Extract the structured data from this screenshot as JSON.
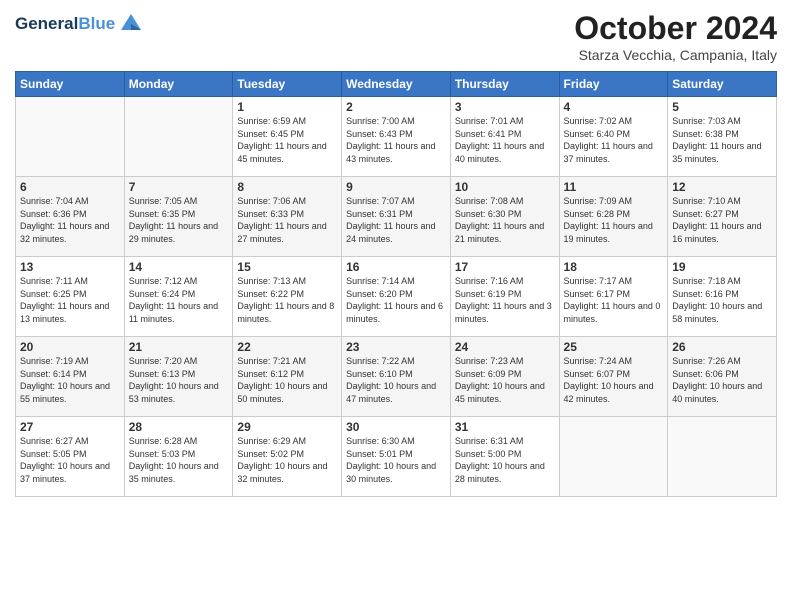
{
  "header": {
    "logo_line1": "General",
    "logo_line2": "Blue",
    "month_title": "October 2024",
    "subtitle": "Starza Vecchia, Campania, Italy"
  },
  "days_of_week": [
    "Sunday",
    "Monday",
    "Tuesday",
    "Wednesday",
    "Thursday",
    "Friday",
    "Saturday"
  ],
  "weeks": [
    [
      {
        "day": "",
        "info": ""
      },
      {
        "day": "",
        "info": ""
      },
      {
        "day": "1",
        "info": "Sunrise: 6:59 AM\nSunset: 6:45 PM\nDaylight: 11 hours and 45 minutes."
      },
      {
        "day": "2",
        "info": "Sunrise: 7:00 AM\nSunset: 6:43 PM\nDaylight: 11 hours and 43 minutes."
      },
      {
        "day": "3",
        "info": "Sunrise: 7:01 AM\nSunset: 6:41 PM\nDaylight: 11 hours and 40 minutes."
      },
      {
        "day": "4",
        "info": "Sunrise: 7:02 AM\nSunset: 6:40 PM\nDaylight: 11 hours and 37 minutes."
      },
      {
        "day": "5",
        "info": "Sunrise: 7:03 AM\nSunset: 6:38 PM\nDaylight: 11 hours and 35 minutes."
      }
    ],
    [
      {
        "day": "6",
        "info": "Sunrise: 7:04 AM\nSunset: 6:36 PM\nDaylight: 11 hours and 32 minutes."
      },
      {
        "day": "7",
        "info": "Sunrise: 7:05 AM\nSunset: 6:35 PM\nDaylight: 11 hours and 29 minutes."
      },
      {
        "day": "8",
        "info": "Sunrise: 7:06 AM\nSunset: 6:33 PM\nDaylight: 11 hours and 27 minutes."
      },
      {
        "day": "9",
        "info": "Sunrise: 7:07 AM\nSunset: 6:31 PM\nDaylight: 11 hours and 24 minutes."
      },
      {
        "day": "10",
        "info": "Sunrise: 7:08 AM\nSunset: 6:30 PM\nDaylight: 11 hours and 21 minutes."
      },
      {
        "day": "11",
        "info": "Sunrise: 7:09 AM\nSunset: 6:28 PM\nDaylight: 11 hours and 19 minutes."
      },
      {
        "day": "12",
        "info": "Sunrise: 7:10 AM\nSunset: 6:27 PM\nDaylight: 11 hours and 16 minutes."
      }
    ],
    [
      {
        "day": "13",
        "info": "Sunrise: 7:11 AM\nSunset: 6:25 PM\nDaylight: 11 hours and 13 minutes."
      },
      {
        "day": "14",
        "info": "Sunrise: 7:12 AM\nSunset: 6:24 PM\nDaylight: 11 hours and 11 minutes."
      },
      {
        "day": "15",
        "info": "Sunrise: 7:13 AM\nSunset: 6:22 PM\nDaylight: 11 hours and 8 minutes."
      },
      {
        "day": "16",
        "info": "Sunrise: 7:14 AM\nSunset: 6:20 PM\nDaylight: 11 hours and 6 minutes."
      },
      {
        "day": "17",
        "info": "Sunrise: 7:16 AM\nSunset: 6:19 PM\nDaylight: 11 hours and 3 minutes."
      },
      {
        "day": "18",
        "info": "Sunrise: 7:17 AM\nSunset: 6:17 PM\nDaylight: 11 hours and 0 minutes."
      },
      {
        "day": "19",
        "info": "Sunrise: 7:18 AM\nSunset: 6:16 PM\nDaylight: 10 hours and 58 minutes."
      }
    ],
    [
      {
        "day": "20",
        "info": "Sunrise: 7:19 AM\nSunset: 6:14 PM\nDaylight: 10 hours and 55 minutes."
      },
      {
        "day": "21",
        "info": "Sunrise: 7:20 AM\nSunset: 6:13 PM\nDaylight: 10 hours and 53 minutes."
      },
      {
        "day": "22",
        "info": "Sunrise: 7:21 AM\nSunset: 6:12 PM\nDaylight: 10 hours and 50 minutes."
      },
      {
        "day": "23",
        "info": "Sunrise: 7:22 AM\nSunset: 6:10 PM\nDaylight: 10 hours and 47 minutes."
      },
      {
        "day": "24",
        "info": "Sunrise: 7:23 AM\nSunset: 6:09 PM\nDaylight: 10 hours and 45 minutes."
      },
      {
        "day": "25",
        "info": "Sunrise: 7:24 AM\nSunset: 6:07 PM\nDaylight: 10 hours and 42 minutes."
      },
      {
        "day": "26",
        "info": "Sunrise: 7:26 AM\nSunset: 6:06 PM\nDaylight: 10 hours and 40 minutes."
      }
    ],
    [
      {
        "day": "27",
        "info": "Sunrise: 6:27 AM\nSunset: 5:05 PM\nDaylight: 10 hours and 37 minutes."
      },
      {
        "day": "28",
        "info": "Sunrise: 6:28 AM\nSunset: 5:03 PM\nDaylight: 10 hours and 35 minutes."
      },
      {
        "day": "29",
        "info": "Sunrise: 6:29 AM\nSunset: 5:02 PM\nDaylight: 10 hours and 32 minutes."
      },
      {
        "day": "30",
        "info": "Sunrise: 6:30 AM\nSunset: 5:01 PM\nDaylight: 10 hours and 30 minutes."
      },
      {
        "day": "31",
        "info": "Sunrise: 6:31 AM\nSunset: 5:00 PM\nDaylight: 10 hours and 28 minutes."
      },
      {
        "day": "",
        "info": ""
      },
      {
        "day": "",
        "info": ""
      }
    ]
  ]
}
